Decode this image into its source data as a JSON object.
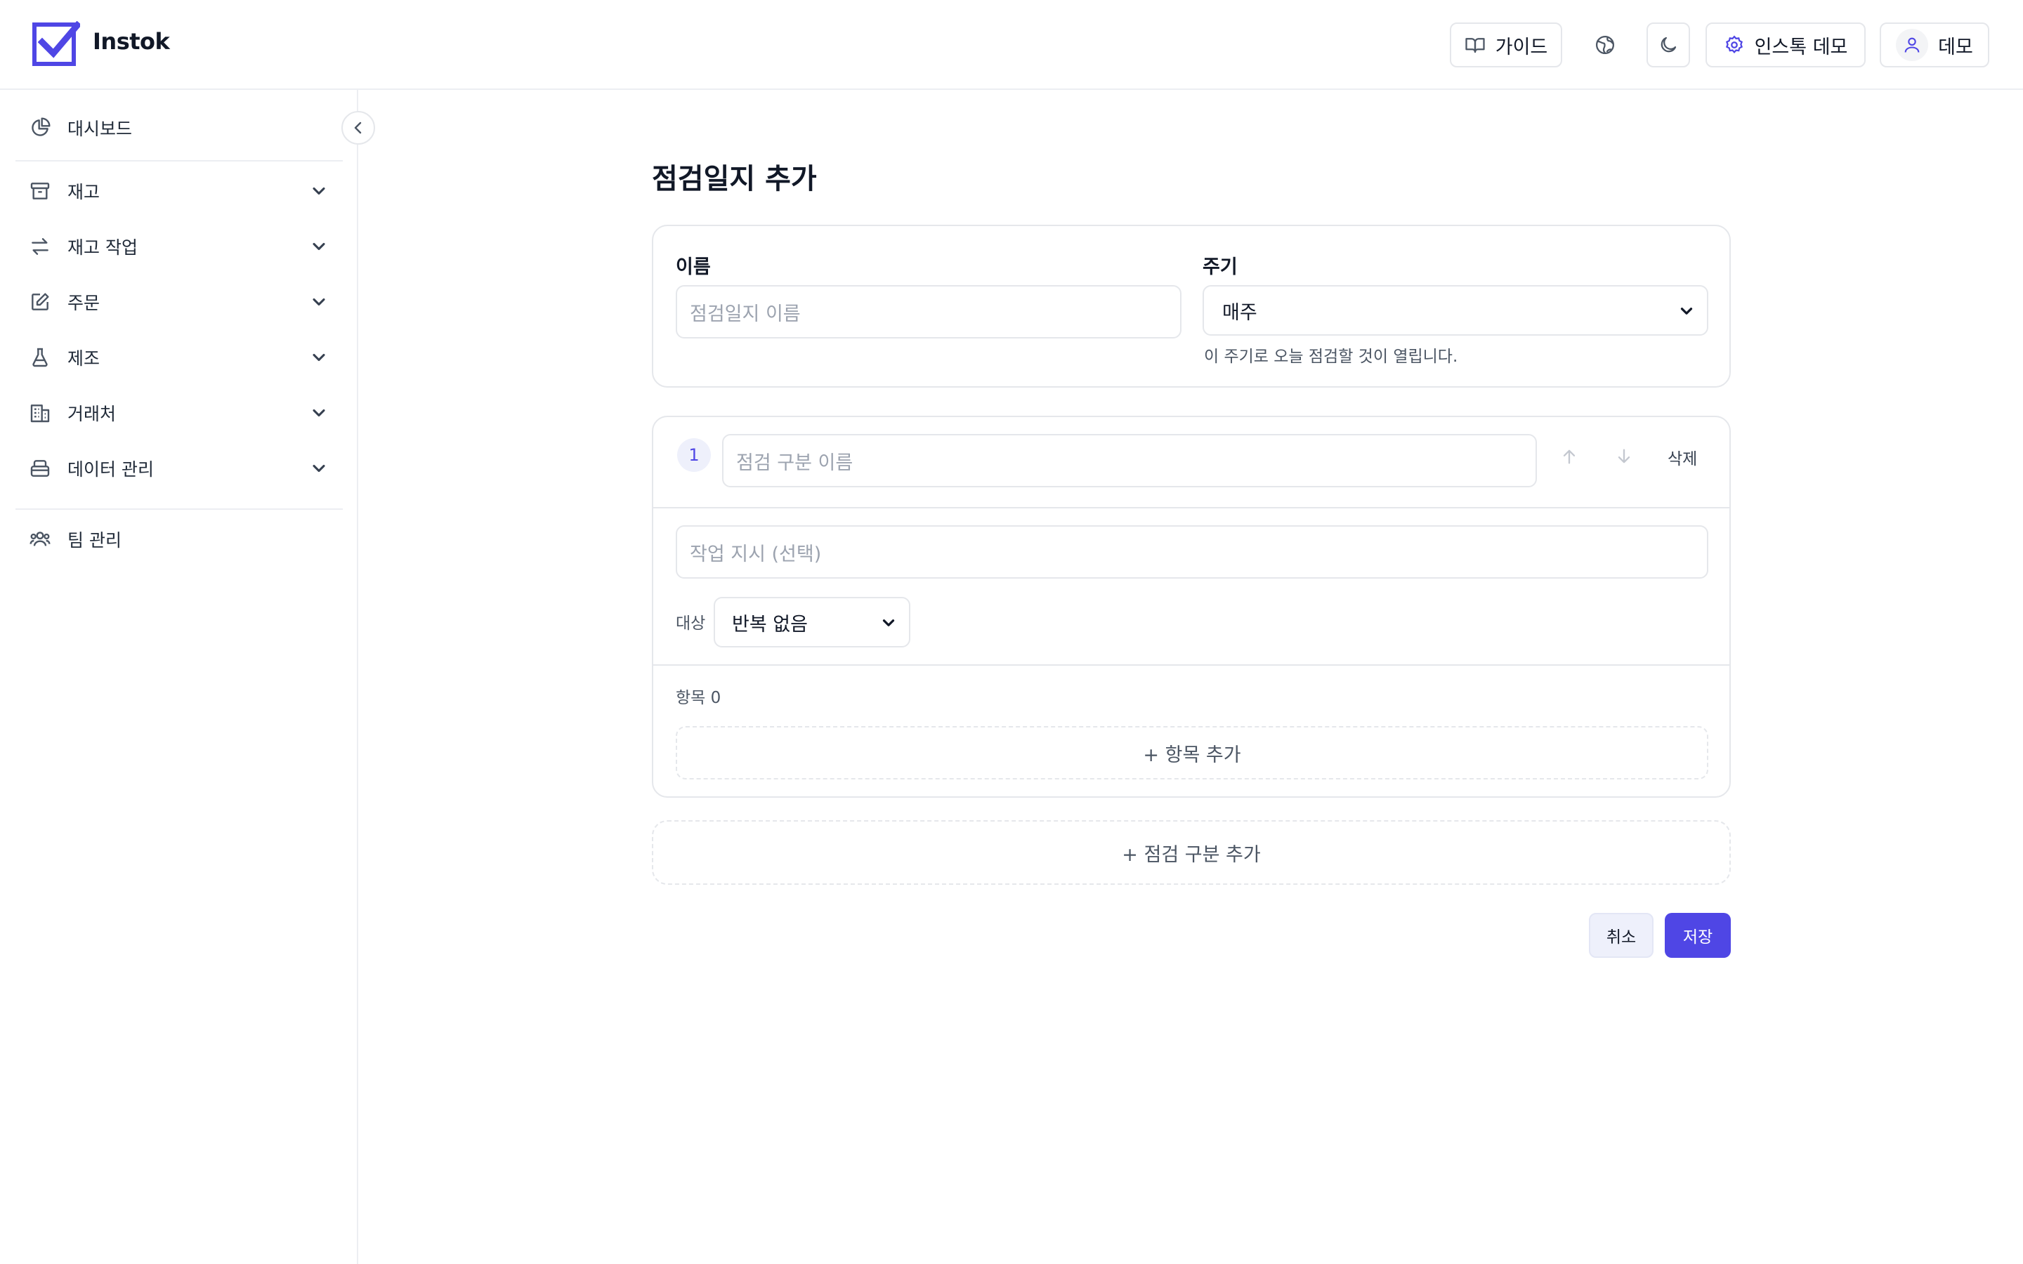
{
  "app": {
    "name": "Instok",
    "accent_color": "#4f46e5"
  },
  "header": {
    "guide_label": "가이드",
    "settings_label": "인스톡 데모",
    "user_label": "데모",
    "icons": [
      "book-icon",
      "globe-icon",
      "moon-icon",
      "gear-icon",
      "user-icon"
    ]
  },
  "sidebar": {
    "items": [
      {
        "label": "대시보드",
        "icon": "pie-chart-icon",
        "expandable": false
      },
      {
        "label": "재고",
        "icon": "archive-icon",
        "expandable": true
      },
      {
        "label": "재고 작업",
        "icon": "arrows-swap-icon",
        "expandable": true
      },
      {
        "label": "주문",
        "icon": "edit-icon",
        "expandable": true
      },
      {
        "label": "제조",
        "icon": "flask-icon",
        "expandable": true
      },
      {
        "label": "거래처",
        "icon": "building-icon",
        "expandable": true
      },
      {
        "label": "데이터 관리",
        "icon": "database-icon",
        "expandable": true
      },
      {
        "label": "팀 관리",
        "icon": "users-icon",
        "expandable": false
      }
    ]
  },
  "page": {
    "title": "점검일지 추가"
  },
  "form": {
    "name_label": "이름",
    "name_placeholder": "점검일지 이름",
    "cycle_label": "주기",
    "cycle_value": "매주",
    "cycle_hint": "이 주기로 오늘 점검할 것이 열립니다."
  },
  "section": {
    "number": "1",
    "name_placeholder": "점검 구분 이름",
    "delete_label": "삭제",
    "instruction_placeholder": "작업 지시 (선택)",
    "target_label": "대상",
    "target_value": "반복 없음",
    "items_count_label": "항목 0",
    "add_item_label": "+ 항목 추가"
  },
  "add_section_label": "+ 점검 구분 추가",
  "actions": {
    "cancel_label": "취소",
    "save_label": "저장"
  }
}
